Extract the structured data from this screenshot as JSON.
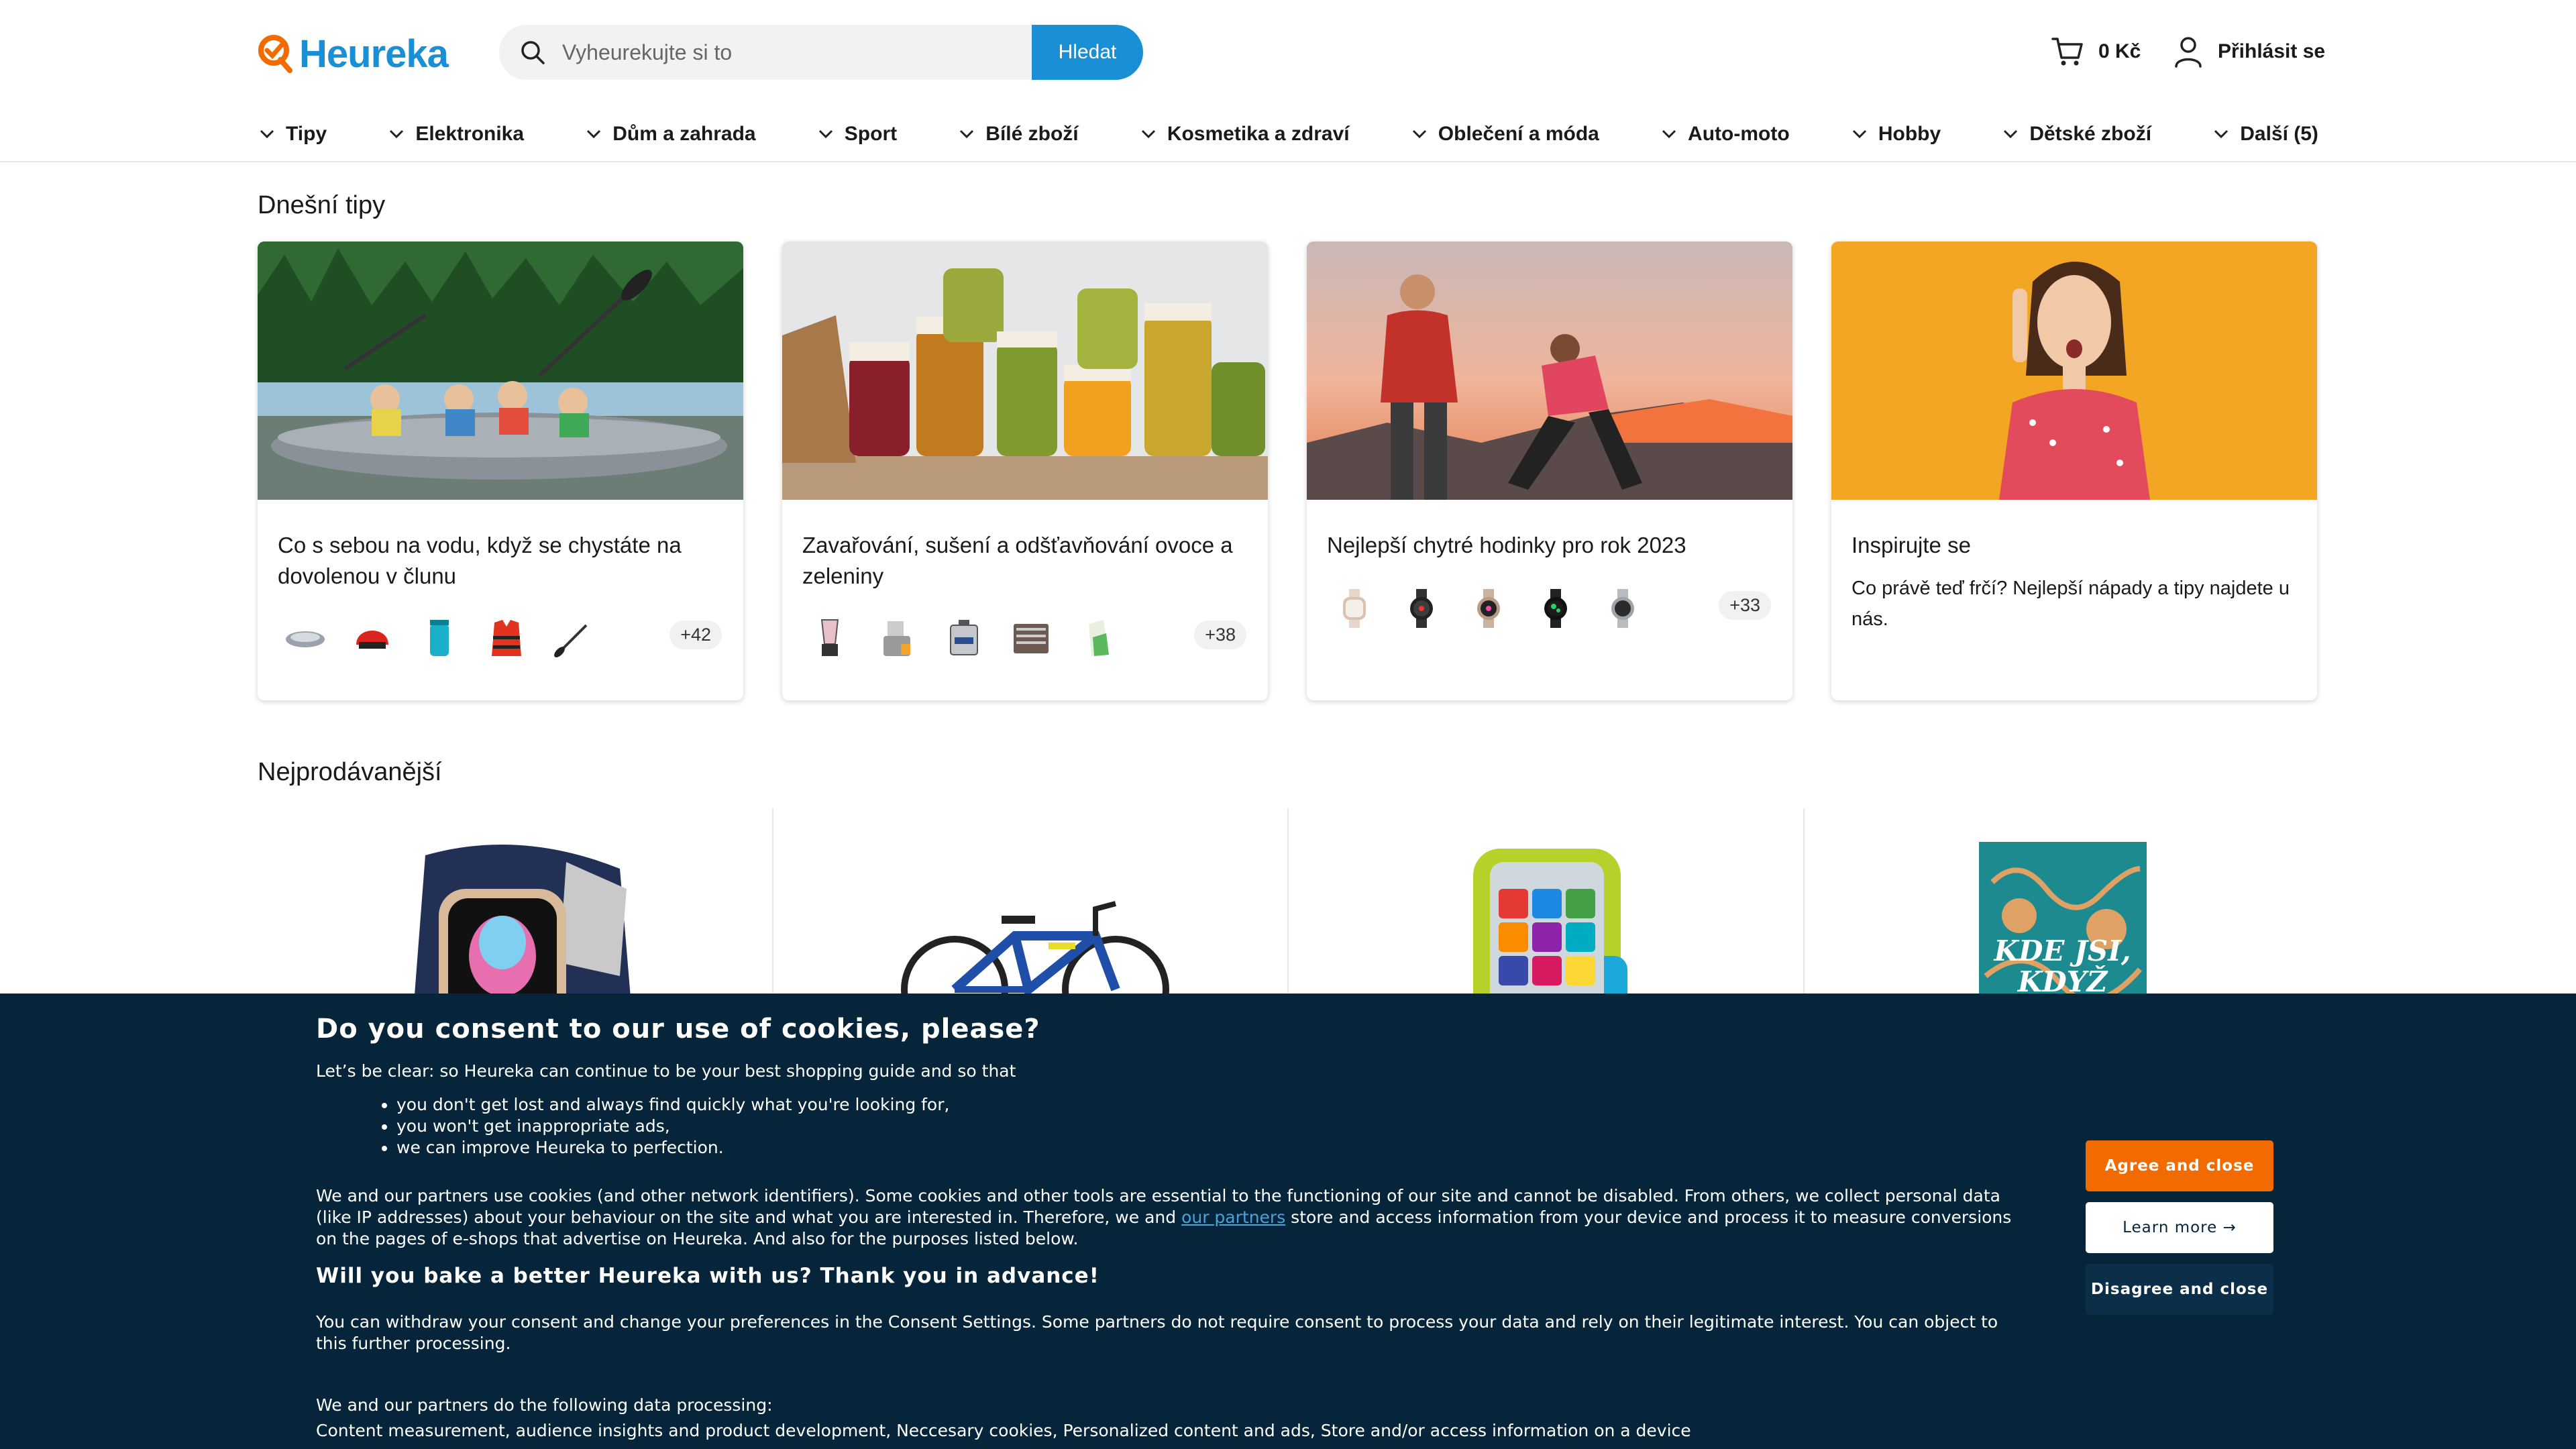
{
  "brand": {
    "name": "Heureka",
    "color": "#1a8fd6",
    "accent": "#f26b00"
  },
  "search": {
    "placeholder": "Vyheurekujte si to",
    "button_label": "Hledat"
  },
  "cart": {
    "label": "0 Kč"
  },
  "account": {
    "login_label": "Přihlásit se"
  },
  "nav": {
    "items": [
      "Tipy",
      "Elektronika",
      "Dům a zahrada",
      "Sport",
      "Bílé zboží",
      "Kosmetika a zdraví",
      "Oblečení a móda",
      "Auto-moto",
      "Hobby",
      "Dětské zboží",
      "Další (5)"
    ]
  },
  "tips": {
    "section_title": "Dnešní tipy",
    "cards": [
      {
        "title": "Co s sebou na vodu, když se chystáte na dovolenou v člunu",
        "more": "+42",
        "thumbs": [
          "inflatable-boat-icon",
          "helmet-icon",
          "dry-bag-icon",
          "life-vest-icon",
          "paddle-icon"
        ]
      },
      {
        "title": "Zavařování, sušení a odšťavňování ovoce a zeleniny",
        "more": "+38",
        "thumbs": [
          "blender-icon",
          "juicer-icon",
          "canning-pot-icon",
          "dehydrator-icon",
          "jar-icon"
        ]
      },
      {
        "title": "Nejlepší chytré hodinky pro rok 2023",
        "more": "+33",
        "thumbs": [
          "watch-icon",
          "watch-icon",
          "watch-icon",
          "watch-icon",
          "watch-icon"
        ]
      },
      {
        "title": "Inspirujte se",
        "description": "Co právě teď frčí? Nejlepší nápady a tipy najdete u nás."
      }
    ]
  },
  "bestsellers": {
    "section_title": "Nejprodávanější",
    "items": [
      "smartwatch",
      "kids-bicycle",
      "toy-phone",
      "book-cover"
    ],
    "book_cover_text": "KDE JSI, KDYŽ NEJSI"
  },
  "cookie_banner": {
    "title": "Do you consent to our use of cookies, please?",
    "intro": "Let’s be clear: so Heureka can continue to be your best shopping guide and so that",
    "bullets": [
      "you don't get lost and always find quickly what you're looking for,",
      "you won't get inappropriate ads,",
      "we can improve Heureka to perfection."
    ],
    "body_before_link": "We and our partners use cookies (and other network identifiers). Some cookies and other tools are essential to the functioning of our site and cannot be disabled. From others, we collect personal data (like IP addresses) about your behaviour on the site and what you are interested in. Therefore, we and ",
    "partners_link": "our partners",
    "body_after_link": " store and access information from your device and process it to measure conversions on the pages of e-shops that advertise on Heureka. And also for the purposes listed below.",
    "subtitle": "Will you bake a better Heureka with us? Thank you in advance!",
    "withdraw": "You can withdraw your consent and change your preferences in the Consent Settings. Some partners do not require consent to process your data and rely on their legitimate interest. You can object to this further processing.",
    "processing_heading": "We and our partners do the following data processing:",
    "processing_list": "Content measurement, audience insights and product development, Neccesary cookies, Personalized content and ads, Store and/or access information on a device",
    "buttons": {
      "agree": "Agree and close",
      "learn": "Learn more →",
      "disagree": "Disagree and close"
    },
    "colors": {
      "background": "#06253a",
      "agree": "#f26b00"
    }
  }
}
